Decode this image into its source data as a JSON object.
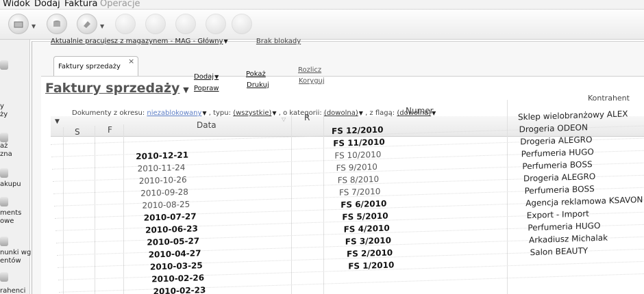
{
  "menu": [
    "Widok",
    "Dodaj",
    "Faktura",
    "Operacje"
  ],
  "status": {
    "prefix": "Aktualnie pracujesz z magazynem - MAG - Główny",
    "lock": "Brak blokady"
  },
  "tab": {
    "label": "Faktury sprzedaży",
    "close": "×"
  },
  "page": {
    "title": "Faktury sprzedaży"
  },
  "actions": {
    "add": "Dodaj",
    "edit": "Popraw",
    "show": "Pokaż",
    "print": "Drukuj",
    "settle": "Rozlicz",
    "correct": "Koryguj"
  },
  "filters": {
    "label": "Dokumenty z okresu:",
    "period": "niezablokowany",
    "type_label": ", typu:",
    "type": "(wszystkie)",
    "category_label": ", o kategorii:",
    "category": "(dowolna)",
    "flag_label": ", z flagą:",
    "flag": "(dowolna)"
  },
  "left_nav": [
    {
      "text": "y"
    },
    {
      "text": "ży"
    },
    {
      "text": "aż"
    },
    {
      "text": "zna"
    },
    {
      "text": "akupu"
    },
    {
      "text": "ments"
    },
    {
      "text": "owe"
    },
    {
      "text": "nunki wg"
    },
    {
      "text": "entów"
    },
    {
      "text": "rahenci"
    }
  ],
  "table": {
    "headers": {
      "s": "S",
      "f": "F",
      "date": "Data",
      "r": "R",
      "number": "Numer",
      "contractor": "Kontrahent"
    },
    "rows": [
      {
        "date": "",
        "number": "FS 12/2010",
        "contractor": "Sklep wielobranżowy  ALEX",
        "bold": true
      },
      {
        "date": "2010-12-21",
        "number": "FS 11/2010",
        "contractor": "Drogeria ODEON",
        "bold": true
      },
      {
        "date": "2010-11-24",
        "number": "FS 10/2010",
        "contractor": "Drogeria ALEGRO",
        "bold": false
      },
      {
        "date": "2010-10-26",
        "number": "FS 9/2010",
        "contractor": "Perfumeria HUGO",
        "bold": false
      },
      {
        "date": "2010-09-28",
        "number": "FS 8/2010",
        "contractor": "Perfumeria BOSS",
        "bold": false
      },
      {
        "date": "2010-08-25",
        "number": "FS 7/2010",
        "contractor": "Drogeria ALEGRO",
        "bold": false
      },
      {
        "date": "2010-07-27",
        "number": "FS 6/2010",
        "contractor": "Perfumeria BOSS",
        "bold": true
      },
      {
        "date": "2010-06-23",
        "number": "FS 5/2010",
        "contractor": "Agencja reklamowa KSAVON",
        "bold": true
      },
      {
        "date": "2010-05-27",
        "number": "FS 4/2010",
        "contractor": "Export - Import",
        "bold": true
      },
      {
        "date": "2010-04-27",
        "number": "FS 3/2010",
        "contractor": "Perfumeria HUGO",
        "bold": true
      },
      {
        "date": "2010-03-25",
        "number": "FS 2/2010",
        "contractor": "Arkadiusz Michalak",
        "bold": true
      },
      {
        "date": "2010-02-26",
        "number": "FS 1/2010",
        "contractor": "Salon BEAUTY",
        "bold": true
      },
      {
        "date": "2010-02-23",
        "number": "",
        "contractor": "",
        "bold": true
      }
    ]
  }
}
